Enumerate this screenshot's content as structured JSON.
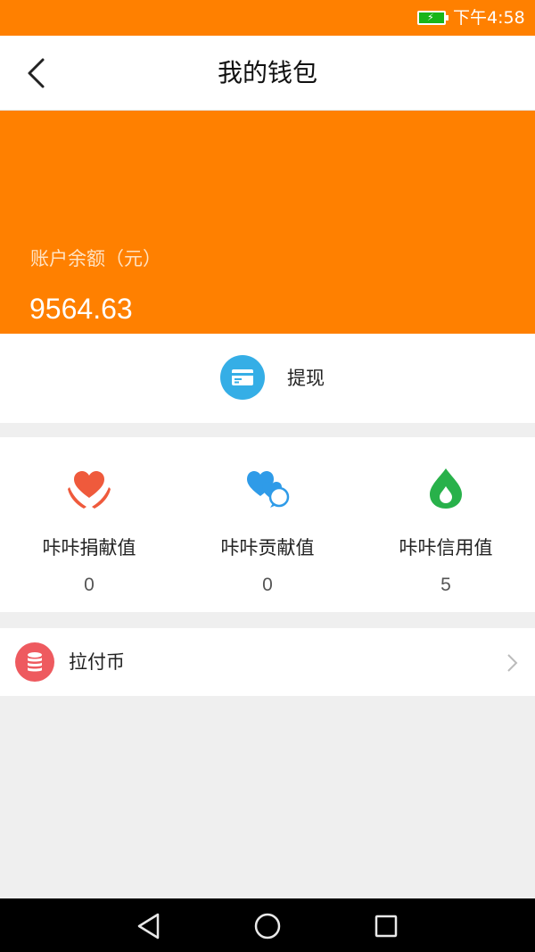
{
  "status_bar": {
    "time": "下午4:58",
    "icons": [
      "battery-charging-icon"
    ]
  },
  "header": {
    "title": "我的钱包",
    "back_icon": "back-arrow-icon"
  },
  "balance": {
    "label": "账户余额（元）",
    "amount": "9564.63"
  },
  "withdraw": {
    "label": "提现",
    "icon": "card-icon"
  },
  "stats": [
    {
      "name": "咔咔捐献值",
      "value": "0",
      "icon": "heart-hands-icon"
    },
    {
      "name": "咔咔贡献值",
      "value": "0",
      "icon": "hearts-chat-icon"
    },
    {
      "name": "咔咔信用值",
      "value": "5",
      "icon": "droplet-icon"
    }
  ],
  "coin": {
    "label": "拉付币",
    "icon": "coin-stack-icon",
    "chevron_icon": "chevron-right-icon"
  },
  "nav_bar": {
    "icons": [
      "back-triangle-icon",
      "home-circle-icon",
      "recents-square-icon"
    ]
  },
  "colors": {
    "brand_orange": "#ff8000",
    "withdraw_blue": "#35aee6",
    "coin_red": "#ee5a5f",
    "donate_red": "#ef5a3c",
    "contribute_blue": "#2f9be8",
    "credit_green": "#28b14a"
  }
}
